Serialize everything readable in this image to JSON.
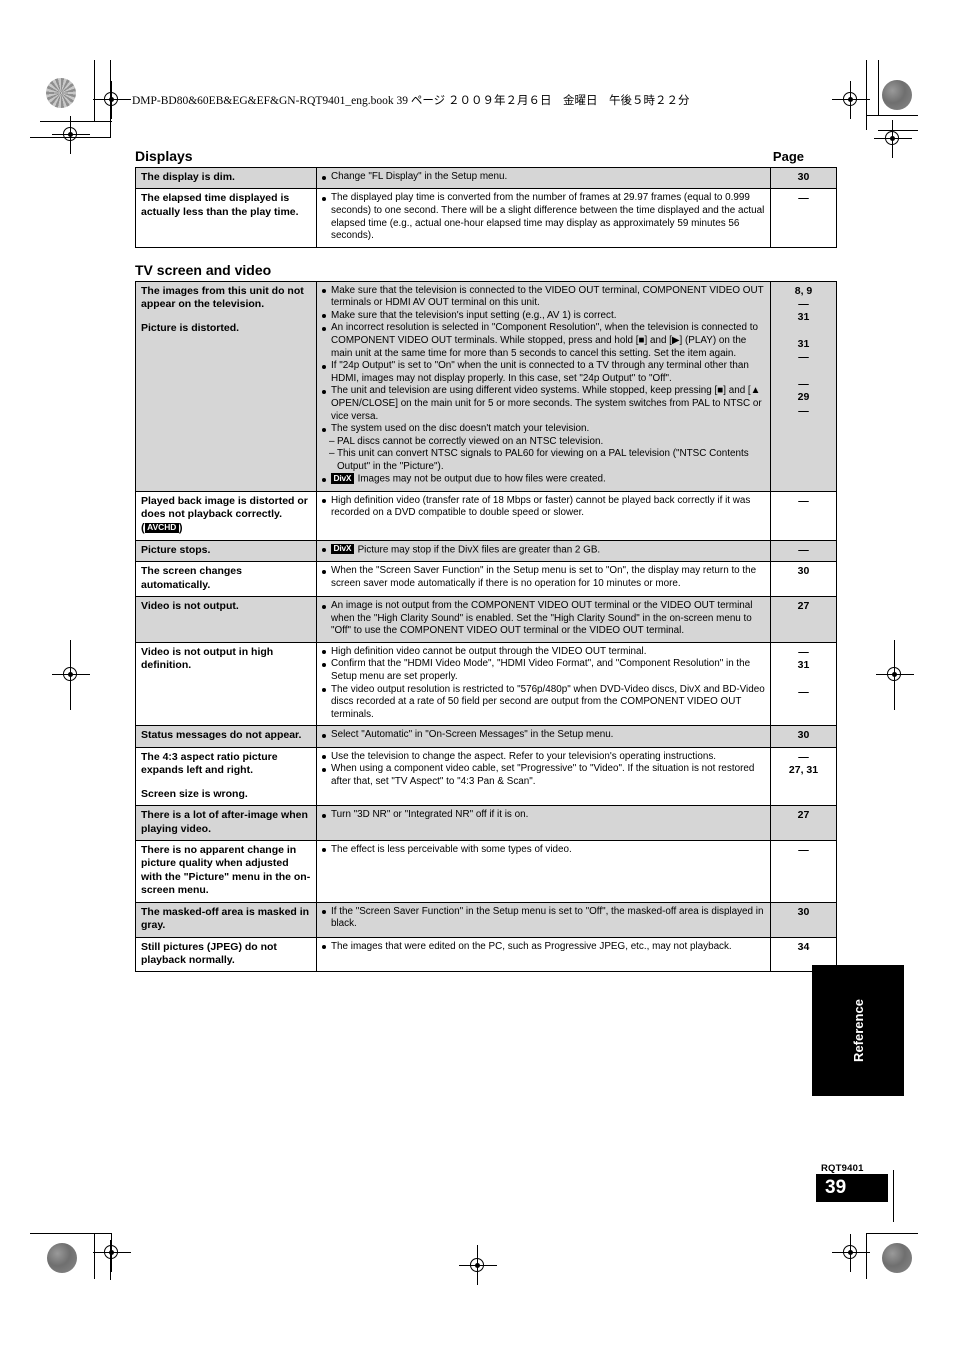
{
  "page": {
    "print_header": "DMP-BD80&60EB&EG&EF&GN-RQT9401_eng.book   39 ページ   ２００９年２月６日　金曜日　午後５時２２分",
    "side_tab_label": "Reference",
    "rqt_code": "RQT9401",
    "page_number": "39"
  },
  "sections": [
    {
      "title": "Displays",
      "page_col_header": "Page",
      "rows": [
        {
          "shaded": true,
          "symptom": [
            "The display is dim."
          ],
          "solutions": [
            {
              "text": "Change \"FL Display\" in the Setup menu."
            }
          ],
          "pages": [
            "30"
          ]
        },
        {
          "shaded": false,
          "symptom": [
            "The elapsed time displayed is actually less than the play time."
          ],
          "solutions": [
            {
              "text": "The displayed play time is converted from the number of frames at 29.97 frames (equal to 0.999 seconds) to one second. There will be a slight difference between the time displayed and the actual elapsed time (e.g., actual one-hour elapsed time may display as approximately 59 minutes 56 seconds)."
            }
          ],
          "pages": [
            "—"
          ]
        }
      ]
    },
    {
      "title": "TV screen and video",
      "page_col_header": "",
      "rows": [
        {
          "shaded": true,
          "symptom": [
            "The images from this unit do not appear on the television.",
            "Picture is distorted."
          ],
          "solutions": [
            {
              "text": "Make sure that the television is connected to the VIDEO OUT terminal, COMPONENT VIDEO OUT terminals or HDMI AV OUT terminal on this unit."
            },
            {
              "text": "Make sure that the television's input setting (e.g., AV 1) is correct."
            },
            {
              "text": "An incorrect resolution is selected in \"Component Resolution\", when the television is connected to COMPONENT VIDEO OUT terminals. While stopped, press and hold [■] and [▶] (PLAY) on the main unit at the same time for more than 5 seconds to cancel this setting. Set the item again."
            },
            {
              "text": "If \"24p Output\" is set to \"On\" when the unit is connected to a TV through any terminal other than HDMI, images may not display properly. In this case, set \"24p Output\" to \"Off\"."
            },
            {
              "text": "The unit and television are using different video systems. While stopped, keep pressing [■] and [▲ OPEN/CLOSE] on the main unit for 5 or more seconds. The system switches from PAL to NTSC or vice versa."
            },
            {
              "text": "The system used on the disc doesn't match your television."
            },
            {
              "dash": true,
              "text": "PAL discs cannot be correctly viewed on an NTSC television."
            },
            {
              "dash": true,
              "text": "This unit can convert NTSC signals to PAL60 for viewing on a PAL television (\"NTSC Contents Output\" in the \"Picture\")."
            },
            {
              "badge": "DivX",
              "text": "Images may not be output due to how files were created."
            }
          ],
          "pages": [
            "8, 9",
            "—",
            "31",
            "",
            "31",
            "—",
            "",
            "—",
            "29",
            "—"
          ]
        },
        {
          "shaded": false,
          "symptom": [
            "Played back image is distorted or does not playback correctly."
          ],
          "symptom_badge": "AVCHD",
          "solutions": [
            {
              "text": "High definition video (transfer rate of 18 Mbps or faster) cannot be played back correctly if it was recorded on a DVD compatible to double speed or slower."
            }
          ],
          "pages": [
            "—"
          ]
        },
        {
          "shaded": true,
          "symptom": [
            "Picture stops."
          ],
          "solutions": [
            {
              "badge": "DivX",
              "text": "Picture may stop if the DivX files are greater than 2 GB."
            }
          ],
          "pages": [
            "—"
          ]
        },
        {
          "shaded": false,
          "symptom": [
            "The screen changes automatically."
          ],
          "solutions": [
            {
              "text": "When the \"Screen Saver Function\" in the Setup menu is set to \"On\", the display may return to the screen saver mode automatically if there is no operation for 10 minutes or more."
            }
          ],
          "pages": [
            "30"
          ]
        },
        {
          "shaded": true,
          "symptom": [
            "Video is not output."
          ],
          "solutions": [
            {
              "text": "An image is not output from the COMPONENT VIDEO OUT terminal or the VIDEO OUT terminal when the \"High Clarity Sound\" is enabled. Set the \"High Clarity Sound\" in the on-screen menu to \"Off\" to use the COMPONENT VIDEO OUT terminal or the VIDEO OUT terminal."
            }
          ],
          "pages": [
            "27"
          ]
        },
        {
          "shaded": false,
          "symptom": [
            "Video is not output in high definition."
          ],
          "solutions": [
            {
              "text": "High definition video cannot be output through the VIDEO OUT terminal."
            },
            {
              "text": "Confirm that the \"HDMI Video Mode\", \"HDMI Video Format\", and \"Component Resolution\" in the Setup menu are set properly."
            },
            {
              "text": "The video output resolution is restricted to \"576p/480p\" when DVD-Video discs, DivX and BD-Video discs recorded at a rate of 50 field per second are output from the COMPONENT VIDEO OUT terminals."
            }
          ],
          "pages": [
            "—",
            "31",
            "",
            "—"
          ]
        },
        {
          "shaded": true,
          "symptom": [
            "Status messages do not appear."
          ],
          "solutions": [
            {
              "text": "Select \"Automatic\" in \"On-Screen Messages\" in the Setup menu."
            }
          ],
          "pages": [
            "30"
          ]
        },
        {
          "shaded": false,
          "symptom": [
            "The 4:3 aspect ratio picture expands left and right.",
            "Screen size is wrong."
          ],
          "solutions": [
            {
              "text": "Use the television to change the aspect. Refer to your television's operating instructions."
            },
            {
              "text": "When using a component video cable, set \"Progressive\" to \"Video\". If the situation is not restored after that, set \"TV Aspect\" to \"4:3 Pan & Scan\"."
            }
          ],
          "pages": [
            "—",
            "27, 31"
          ]
        },
        {
          "shaded": true,
          "symptom": [
            "There is a lot of after-image when playing video."
          ],
          "solutions": [
            {
              "text": "Turn \"3D NR\" or \"Integrated NR\" off if it is on."
            }
          ],
          "pages": [
            "27"
          ]
        },
        {
          "shaded": false,
          "symptom": [
            "There is no apparent change in picture quality when adjusted with the \"Picture\" menu in the on-screen menu."
          ],
          "solutions": [
            {
              "text": "The effect is less perceivable with some types of video."
            }
          ],
          "pages": [
            "—"
          ]
        },
        {
          "shaded": true,
          "symptom": [
            "The masked-off area is masked in gray."
          ],
          "solutions": [
            {
              "text": "If the \"Screen Saver Function\" in the Setup menu is set to \"Off\", the masked-off area is displayed in black."
            }
          ],
          "pages": [
            "30"
          ]
        },
        {
          "shaded": false,
          "symptom": [
            "Still pictures (JPEG) do not playback normally."
          ],
          "solutions": [
            {
              "text": "The images that were edited on the PC, such as Progressive JPEG, etc., may not playback."
            }
          ],
          "pages": [
            "34"
          ]
        }
      ]
    }
  ]
}
